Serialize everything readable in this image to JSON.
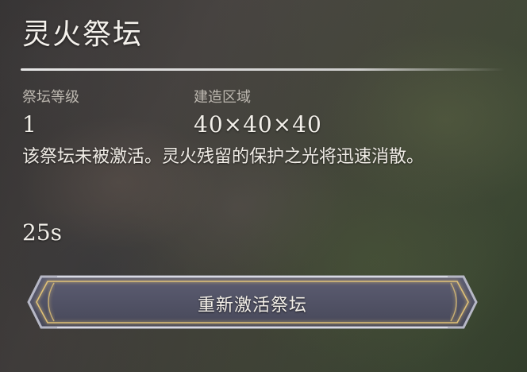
{
  "panel": {
    "title": "灵火祭坛",
    "level_label": "祭坛等级",
    "level_value": "1",
    "area_label": "建造区域",
    "area_value": "40×40×40",
    "description": "该祭坛未被激活。灵火残留的保护之光将迅速消散。",
    "timer": "25s"
  },
  "button": {
    "label": "重新激活祭坛"
  },
  "colors": {
    "text": "#f2efe9",
    "label": "#bdb8b0",
    "button_fill": "#525366",
    "button_glow": "#e8c778",
    "button_frame": "#b7b8c6"
  }
}
